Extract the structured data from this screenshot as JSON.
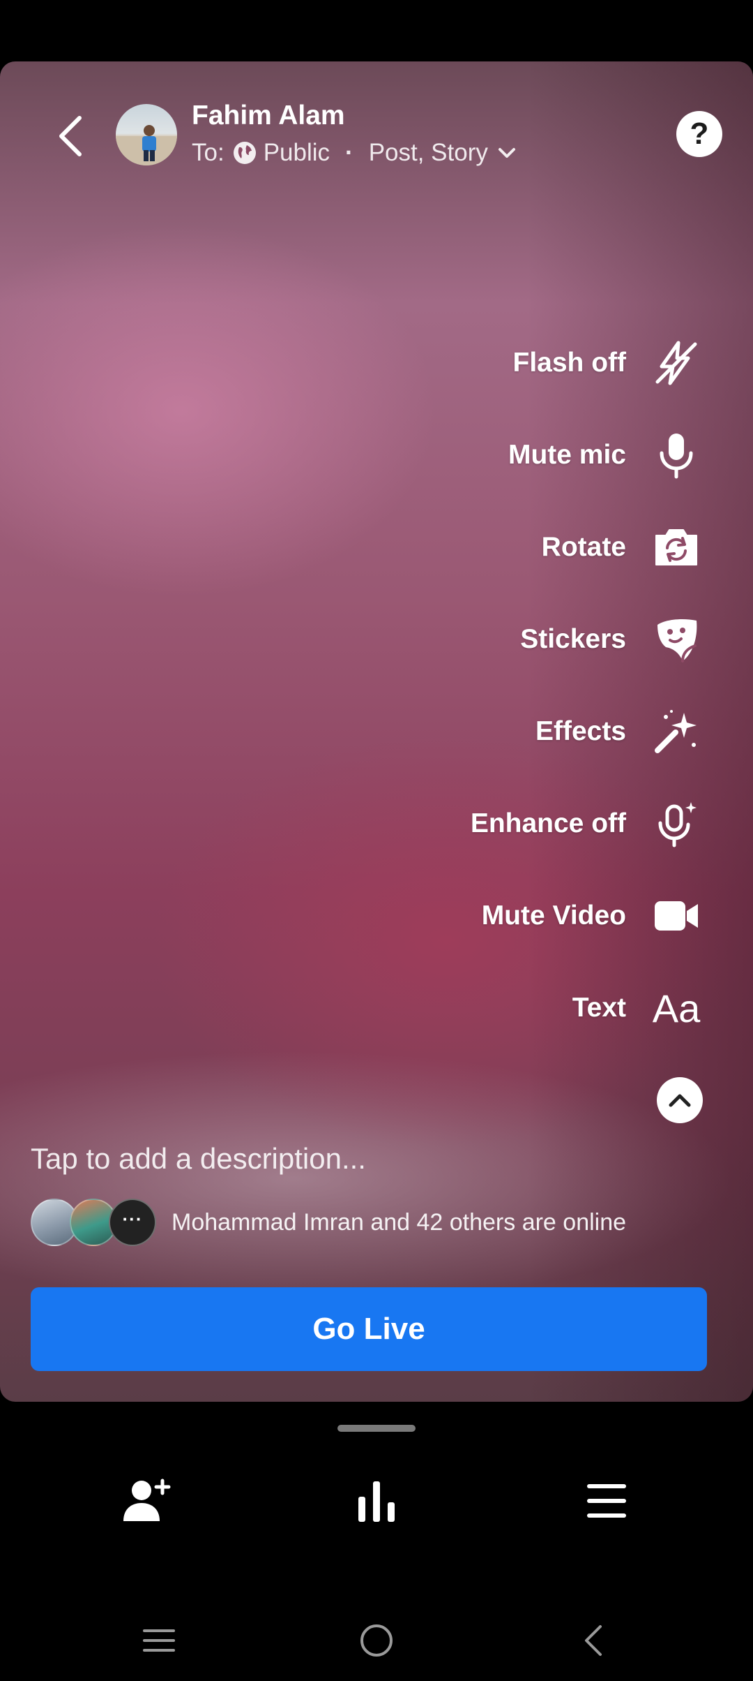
{
  "header": {
    "user_name": "Fahim Alam",
    "audience_prefix": "To:",
    "audience_value": "Public",
    "separator": "·",
    "destination": "Post, Story",
    "help_label": "?"
  },
  "tools": [
    {
      "label": "Flash off",
      "icon": "flash-off-icon"
    },
    {
      "label": "Mute mic",
      "icon": "microphone-icon"
    },
    {
      "label": "Rotate",
      "icon": "rotate-camera-icon"
    },
    {
      "label": "Stickers",
      "icon": "sticker-icon"
    },
    {
      "label": "Effects",
      "icon": "magic-wand-icon"
    },
    {
      "label": "Enhance off",
      "icon": "enhance-mic-icon"
    },
    {
      "label": "Mute Video",
      "icon": "video-camera-icon"
    },
    {
      "label": "Text",
      "icon": "text-icon"
    }
  ],
  "text_icon_glyph": "Aa",
  "description_placeholder": "Tap to add a description...",
  "online": {
    "more_glyph": "···",
    "text": "Mohammad Imran and 42 others are online"
  },
  "go_live_label": "Go Live",
  "bottom_tabs": [
    "add-friend-icon",
    "bar-chart-icon",
    "menu-icon"
  ],
  "system_nav": [
    "recent-apps-icon",
    "home-icon",
    "back-icon"
  ],
  "colors": {
    "go_live_bg": "#1877f2",
    "background": "#000000"
  }
}
